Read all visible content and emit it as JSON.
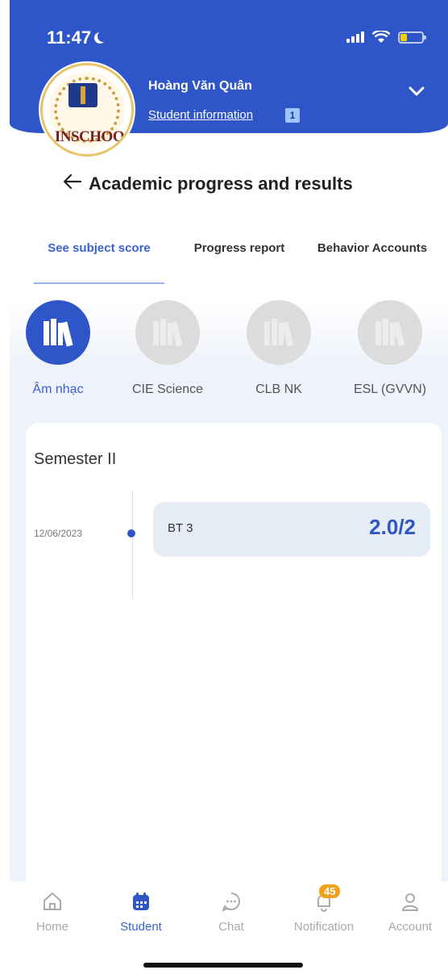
{
  "status_bar": {
    "time": "11:47"
  },
  "header": {
    "logo_text": "INSCHOO",
    "user_name": "Hoàng Văn Quân",
    "user_link": "Student information",
    "badge": "1"
  },
  "page": {
    "title": "Academic progress and results"
  },
  "tabs": [
    {
      "label": "See subject score",
      "active": true
    },
    {
      "label": "Progress report",
      "active": false
    },
    {
      "label": "Behavior Accounts",
      "active": false
    }
  ],
  "subjects": [
    {
      "label": "Âm nhạc",
      "active": true
    },
    {
      "label": "CIE Science",
      "active": false
    },
    {
      "label": "CLB NK",
      "active": false
    },
    {
      "label": "ESL (GVVN)",
      "active": false
    }
  ],
  "card": {
    "semester": "Semester II",
    "entries": [
      {
        "date": "12/06/2023",
        "name": "BT 3",
        "score": "2.0/2"
      }
    ]
  },
  "bottom_nav": {
    "items": [
      {
        "label": "Home",
        "icon": "home-icon",
        "active": false
      },
      {
        "label": "Student",
        "icon": "calendar-icon",
        "active": true
      },
      {
        "label": "Chat",
        "icon": "chat-icon",
        "active": false
      },
      {
        "label": "Notification",
        "icon": "bell-icon",
        "active": false,
        "badge": "45"
      },
      {
        "label": "Account",
        "icon": "user-icon",
        "active": false
      }
    ]
  },
  "colors": {
    "primary": "#2f56c8",
    "badge": "#f2a01b",
    "entry_bg": "#e6ecf6"
  }
}
